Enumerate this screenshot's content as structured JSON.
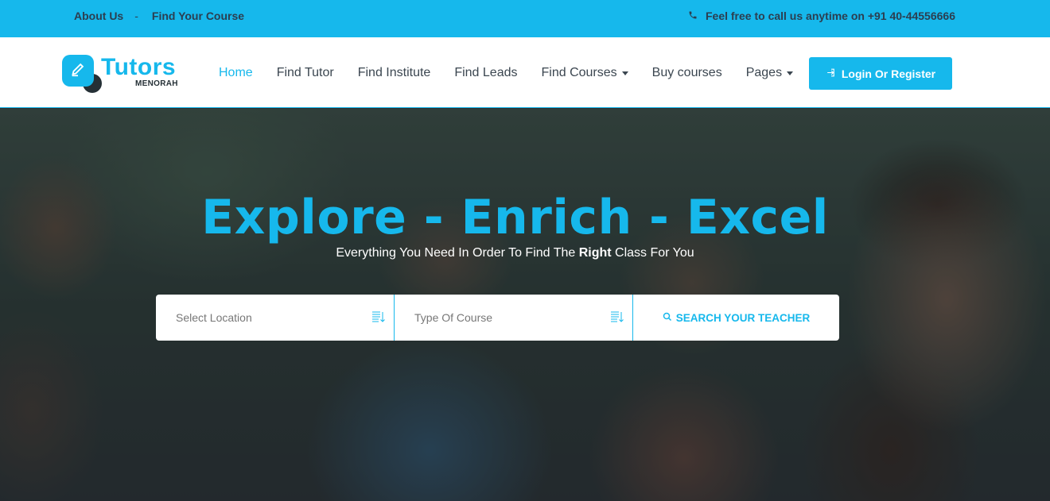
{
  "topbar": {
    "links": [
      "About Us",
      "Find Your Course"
    ],
    "separator": "-",
    "call_text": "Feel free to call us anytime on +91 40-44556666",
    "phone_icon": "phone-icon"
  },
  "header": {
    "logo": {
      "name": "Tutors",
      "sub": "MENORAH"
    },
    "nav": [
      {
        "label": "Home",
        "active": true
      },
      {
        "label": "Find Tutor"
      },
      {
        "label": "Find Institute"
      },
      {
        "label": "Find Leads"
      },
      {
        "label": "Find Courses",
        "dropdown": true
      },
      {
        "label": "Buy courses"
      },
      {
        "label": "Pages",
        "dropdown": true
      }
    ],
    "login_label": "Login Or Register"
  },
  "hero": {
    "title": "Explore - Enrich - Excel",
    "subtitle_before": "Everything You Need In Order To Find The ",
    "subtitle_bold": "Right",
    "subtitle_after": " Class For You",
    "search": {
      "location_placeholder": "Select Location",
      "course_placeholder": "Type Of Course",
      "button_label": "SEARCH YOUR TEACHER"
    }
  },
  "colors": {
    "accent": "#16b8ec",
    "dark": "#253036",
    "text": "#3b4650"
  }
}
